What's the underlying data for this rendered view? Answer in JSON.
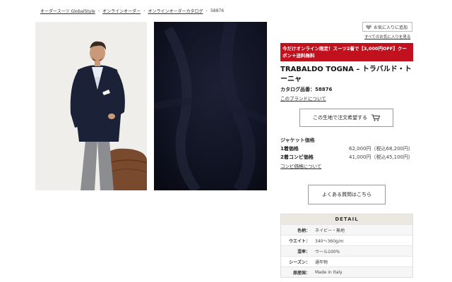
{
  "breadcrumb": {
    "items": [
      "オーダースーツ GlobalStyle",
      "オンラインオーダー",
      "オンラインオーダーカタログ",
      "58876"
    ],
    "separator": "›"
  },
  "favorite": {
    "button_label": "お気に入りに追加",
    "view_all_link": "すべてのお気に入りを見る"
  },
  "promo": {
    "text": "今だけオンライン限定！スーツ2着で【3,000円OFF】クーポン＋送料無料",
    "color": "#c1111f"
  },
  "product": {
    "title": "TRABALDO TOGNA – トラバルド・トーニャ",
    "catalog_label": "カタログ品番：58876",
    "brand_link": "このブランドについて"
  },
  "order_button": {
    "label": "この生地で注文希望する",
    "icon": "cart-icon"
  },
  "pricing": {
    "heading": "ジャケット価格",
    "rows": [
      {
        "label": "1着価格",
        "value": "62,000円（税込68,200円）"
      },
      {
        "label": "2着コンビ価格",
        "value": "41,000円（税込45,100円）"
      }
    ],
    "combo_link": "コンビ価格について"
  },
  "faq_button": {
    "label": "よくある質問はこちら"
  },
  "detail": {
    "heading": "DETAIL",
    "rows": [
      {
        "key": "色柄：",
        "value": "ネイビー・無地"
      },
      {
        "key": "ウエイト：",
        "value": "340～360g/m"
      },
      {
        "key": "混率：",
        "value": "ウール100%"
      },
      {
        "key": "シーズン：",
        "value": "通年物"
      },
      {
        "key": "原産国：",
        "value": "Made in Italy"
      }
    ]
  }
}
